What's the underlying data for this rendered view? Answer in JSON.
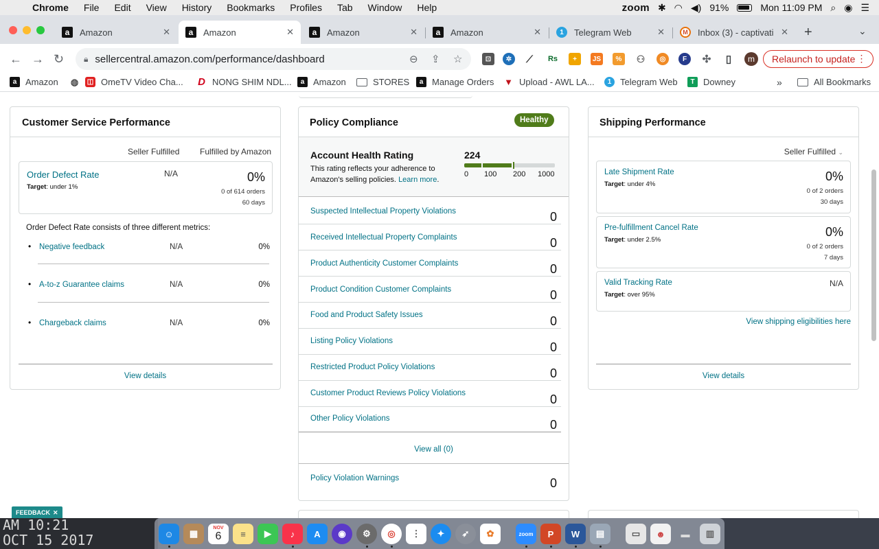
{
  "menubar": {
    "app": "Chrome",
    "items": [
      "File",
      "Edit",
      "View",
      "History",
      "Bookmarks",
      "Profiles",
      "Tab",
      "Window",
      "Help"
    ],
    "zoom": "zoom",
    "battery": "91%",
    "clock": "Mon 11:09 PM"
  },
  "tabs": [
    {
      "title": "Amazon",
      "active": false
    },
    {
      "title": "Amazon",
      "active": true
    },
    {
      "title": "Amazon",
      "active": false
    },
    {
      "title": "Amazon",
      "active": false
    },
    {
      "title": "Telegram Web",
      "active": false
    },
    {
      "title": "Inbox (3) - captivati",
      "active": false
    }
  ],
  "toolbar": {
    "url": "sellercentral.amazon.com/performance/dashboard",
    "relaunch": "Relaunch to update",
    "avatar": "m"
  },
  "bookmarks": [
    "Amazon",
    "OmeTV Video Cha...",
    "NONG SHIM NDL...",
    "Amazon",
    "STORES",
    "Manage Orders",
    "Upload - AWL LA...",
    "Telegram Web",
    "Downey",
    "All Bookmarks"
  ],
  "customer_service": {
    "title": "Customer Service Performance",
    "col1": "Seller Fulfilled",
    "col2": "Fulfilled by Amazon",
    "odr_label": "Order Defect Rate",
    "odr_target_prefix": "Target",
    "odr_target": ": under 1%",
    "odr_seller": "N/A",
    "odr_value": "0%",
    "odr_orders": "0 of 614 orders",
    "odr_days": "60 days",
    "metrics_intro": "Order Defect Rate consists of three different metrics:",
    "metrics": [
      {
        "label": "Negative feedback",
        "seller": "N/A",
        "fba": "0%"
      },
      {
        "label": "A-to-z Guarantee claims",
        "seller": "N/A",
        "fba": "0%"
      },
      {
        "label": "Chargeback claims",
        "seller": "N/A",
        "fba": "0%"
      }
    ],
    "view_details": "View details"
  },
  "policy": {
    "title": "Policy Compliance",
    "badge": "Healthy",
    "ahr_title": "Account Health Rating",
    "ahr_desc1": "This rating reflects your adherence to",
    "ahr_desc2": "Amazon's selling policies.",
    "ahr_learn": "Learn more",
    "ahr_period": ".",
    "ahr_score": "224",
    "ahr_ticks": [
      "0",
      "100",
      "200",
      "1000"
    ],
    "violations": [
      {
        "label": "Suspected Intellectual Property Violations",
        "count": "0"
      },
      {
        "label": "Received Intellectual Property Complaints",
        "count": "0"
      },
      {
        "label": "Product Authenticity Customer Complaints",
        "count": "0"
      },
      {
        "label": "Product Condition Customer Complaints",
        "count": "0"
      },
      {
        "label": "Food and Product Safety Issues",
        "count": "0"
      },
      {
        "label": "Listing Policy Violations",
        "count": "0"
      },
      {
        "label": "Restricted Product Policy Violations",
        "count": "0"
      },
      {
        "label": "Customer Product Reviews Policy Violations",
        "count": "0"
      },
      {
        "label": "Other Policy Violations",
        "count": "0"
      }
    ],
    "view_all": "View all (0)",
    "warnings_label": "Policy Violation Warnings",
    "warnings_count": "0"
  },
  "shipping": {
    "title": "Shipping Performance",
    "filter": "Seller Fulfilled",
    "metrics": [
      {
        "label": "Late Shipment Rate",
        "target": ": under 4%",
        "value": "0%",
        "orders": "0 of 2 orders",
        "days": "30 days"
      },
      {
        "label": "Pre-fulfillment Cancel Rate",
        "target": ": under 2.5%",
        "value": "0%",
        "orders": "0 of 2 orders",
        "days": "7 days"
      },
      {
        "label": "Valid Tracking Rate",
        "target": ": over 95%",
        "value": "N/A"
      }
    ],
    "target_prefix": "Target",
    "eligibility_link": "View shipping eligibilities here",
    "view_details": "View details"
  },
  "feedback": "FEEDBACK",
  "wallpaper": {
    "line1": "AM 10:21",
    "line2": "OCT 15 2017"
  },
  "calendar": {
    "month": "NOV",
    "day": "6"
  },
  "dock_icons": [
    "finder-icon",
    "launchpad-icon",
    "calendar-icon",
    "notes-icon",
    "facetime-icon",
    "music-icon",
    "app-store-icon",
    "siri-icon",
    "system-preferences-icon",
    "chrome-icon",
    "reminders-icon",
    "safari-icon",
    "rocket-icon",
    "photos-icon",
    "zoom-icon",
    "powerpoint-icon",
    "word-icon",
    "preview-icon",
    "file-icon",
    "image-icon",
    "line-icon",
    "trash-icon"
  ],
  "colors": {
    "healthy": "#507c1a",
    "link": "#007185",
    "relaunch": "#d93025"
  }
}
